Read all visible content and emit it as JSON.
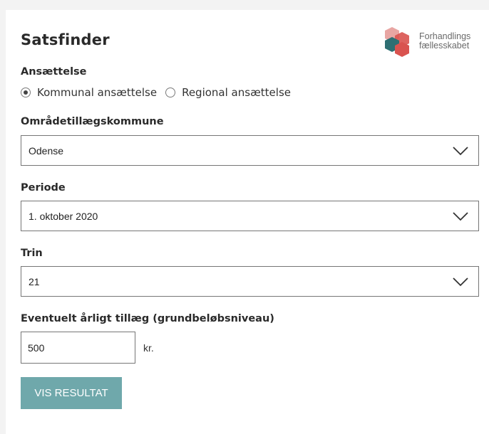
{
  "title": "Satsfinder",
  "logo": {
    "line1": "Forhandlings",
    "line2": "fællesskabet",
    "icon": "forhandlingsfaellesskabet-logo"
  },
  "employment": {
    "label": "Ansættelse",
    "options": [
      {
        "label": "Kommunal ansættelse",
        "checked": true
      },
      {
        "label": "Regional ansættelse",
        "checked": false
      }
    ]
  },
  "area": {
    "label": "Områdetillægskommune",
    "value": "Odense"
  },
  "period": {
    "label": "Periode",
    "value": "1. oktober 2020"
  },
  "step": {
    "label": "Trin",
    "value": "21"
  },
  "supplement": {
    "label": "Eventuelt årligt tillæg (grundbeløbsniveau)",
    "value": "500",
    "unit": "kr."
  },
  "submit": {
    "label": "VIS RESULTAT"
  },
  "colors": {
    "button": "#6fa8ab",
    "logo_red": "#d9534f",
    "logo_teal": "#2e6f73",
    "logo_pink": "#e8a6a3"
  }
}
